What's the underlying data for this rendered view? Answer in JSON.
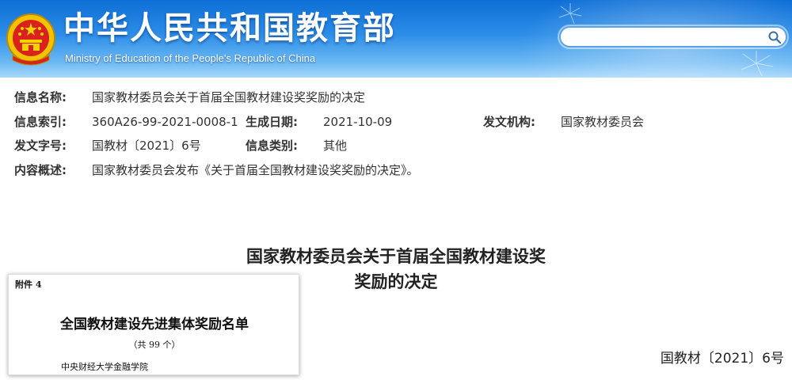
{
  "header": {
    "site_title": "中华人民共和国教育部",
    "site_subtitle": "Ministry of Education of the People's Republic of China",
    "search": {
      "value": "",
      "placeholder": ""
    },
    "icons": {
      "emblem": "national-emblem-icon",
      "search": "search-icon"
    },
    "colors": {
      "bar_top": "#0d6ed6",
      "bar_bottom": "#a9d8fb"
    }
  },
  "info": {
    "name_label": "信息名称:",
    "name_value": "国家教材委员会关于首届全国教材建设奖奖励的决定",
    "index_label": "信息索引:",
    "index_value": "360A26-99-2021-0008-1",
    "date_label": "生成日期:",
    "date_value": "2021-10-09",
    "issuer_label": "发文机构:",
    "issuer_value": "国家教材委员会",
    "docno_label": "发文字号:",
    "docno_value": "国教材〔2021〕6号",
    "category_label": "信息类别:",
    "category_value": "其他",
    "summary_label": "内容概述:",
    "summary_value": "国家教材委员会发布《关于首届全国教材建设奖奖励的决定》。"
  },
  "article": {
    "title_line1": "国家教材委员会关于首届全国教材建设奖",
    "title_line2": "奖励的决定",
    "doc_number": "国教材〔2021〕6号"
  },
  "attachment": {
    "label": "附件 4",
    "title": "全国教材建设先进集体奖励名单",
    "count": "（共 99 个）",
    "first_item": "中央财经大学金融学院"
  }
}
